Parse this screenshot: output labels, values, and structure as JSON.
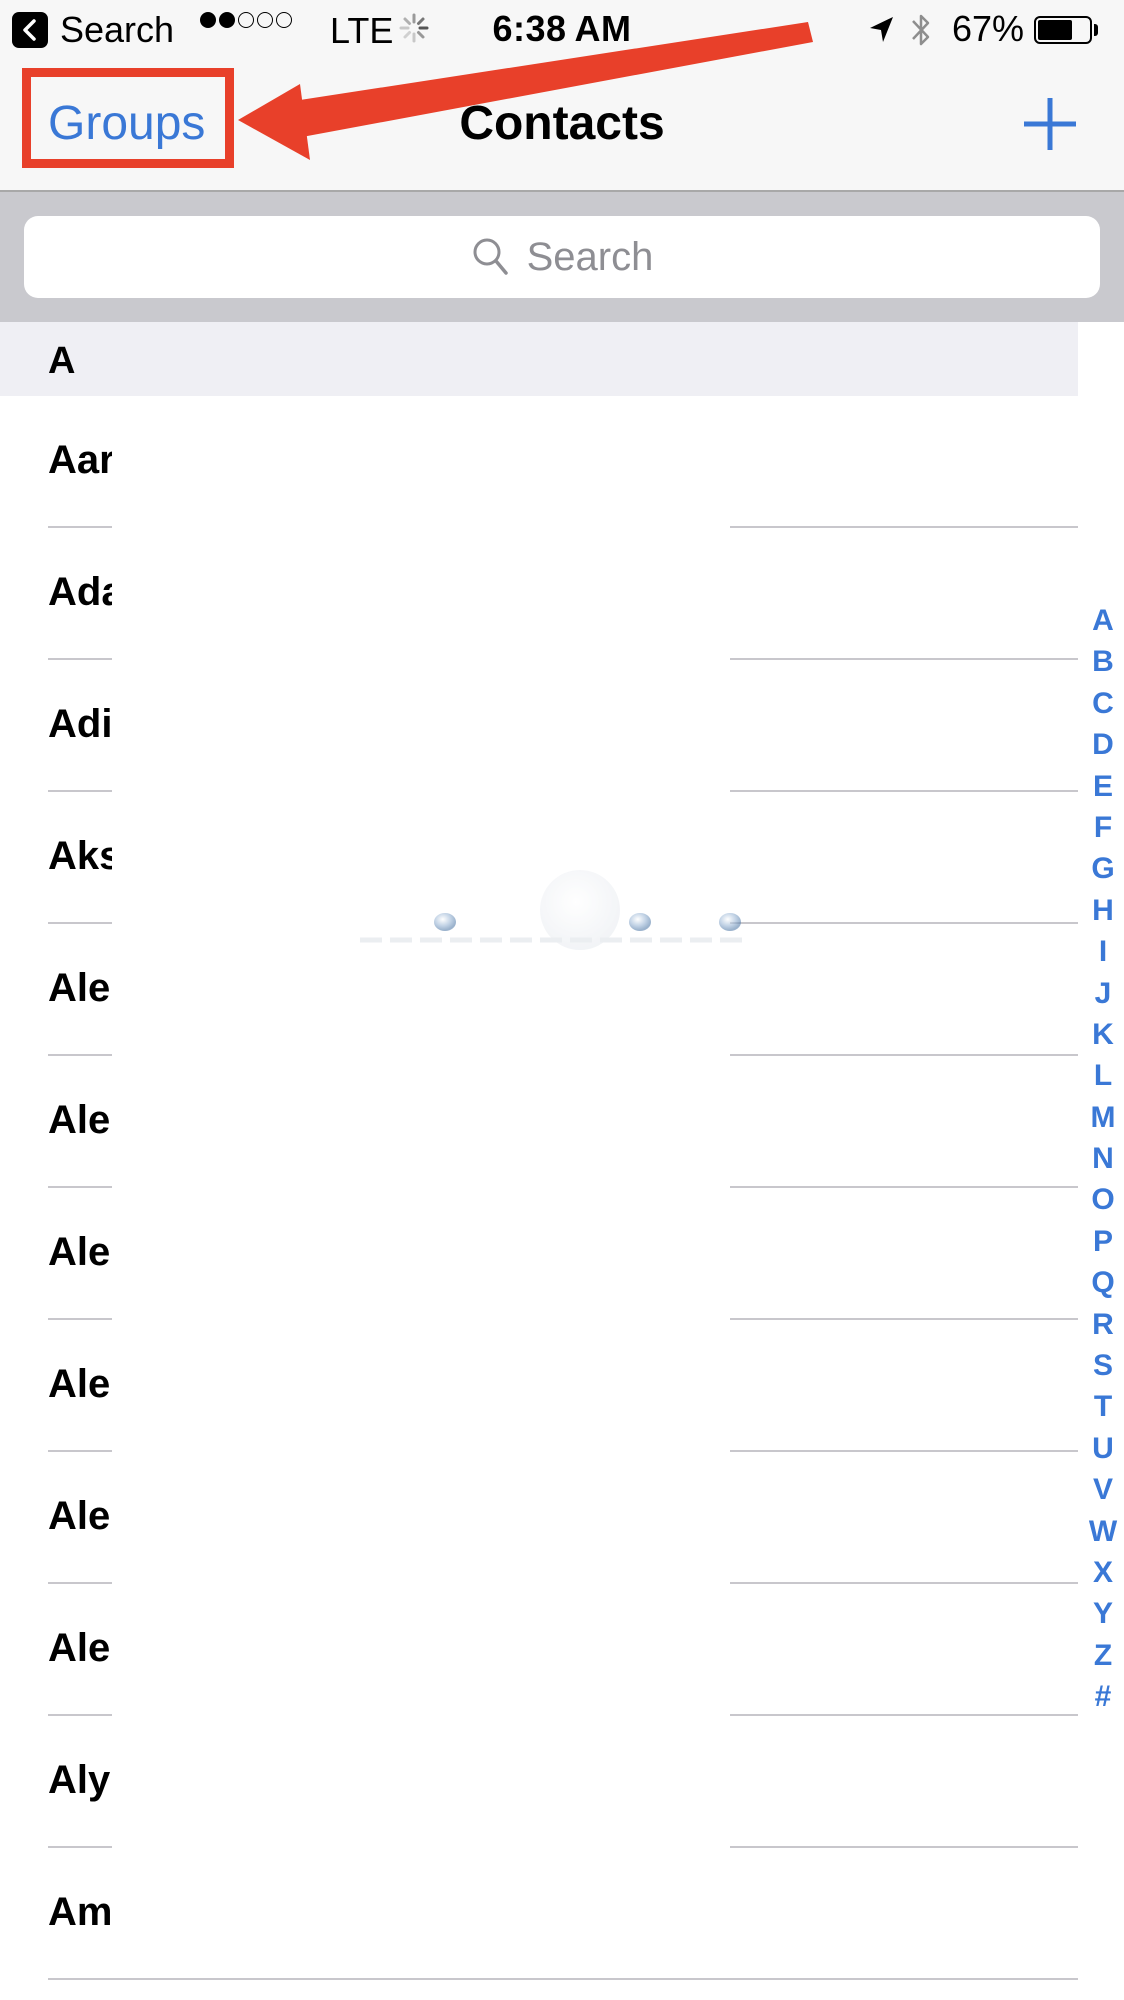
{
  "status_bar": {
    "back_app_label": "Search",
    "signal_bars_filled": 2,
    "signal_bars_total": 5,
    "carrier": "LTE",
    "time": "6:38",
    "time_suffix": "AM",
    "battery_percent_label": "67%",
    "battery_level": 0.67,
    "icons": [
      "back-chevron-icon",
      "activity-spinner-icon",
      "location-arrow-icon",
      "bluetooth-icon",
      "battery-icon"
    ]
  },
  "nav_bar": {
    "left_button": "Groups",
    "title": "Contacts",
    "right_button_icon": "plus-icon"
  },
  "search": {
    "placeholder": "Search",
    "value": ""
  },
  "list": {
    "section_header": "A",
    "contacts": [
      {
        "name": "Aar"
      },
      {
        "name": "Ada"
      },
      {
        "name": "Adi"
      },
      {
        "name": "Aks"
      },
      {
        "name": "Ale"
      },
      {
        "name": "Ale"
      },
      {
        "name": "Ale"
      },
      {
        "name": "Ale"
      },
      {
        "name": "Ale"
      },
      {
        "name": "Ale"
      },
      {
        "name": "Aly"
      },
      {
        "name": "Am"
      }
    ]
  },
  "index": [
    "A",
    "B",
    "C",
    "D",
    "E",
    "F",
    "G",
    "H",
    "I",
    "J",
    "K",
    "L",
    "M",
    "N",
    "O",
    "P",
    "Q",
    "R",
    "S",
    "T",
    "U",
    "V",
    "W",
    "X",
    "Y",
    "Z",
    "#"
  ],
  "annotation": {
    "type": "red box and arrow pointing to Groups button",
    "color": "#e8402a"
  },
  "colors": {
    "accent": "#3a78d6",
    "nav_background": "#f7f7f7",
    "search_background": "#c9c9ce",
    "section_background": "#efeff4",
    "separator": "#c8c7cc"
  }
}
